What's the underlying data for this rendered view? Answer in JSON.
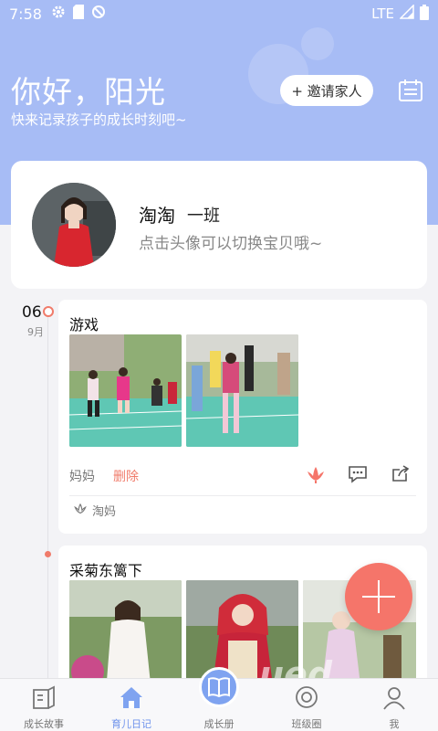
{
  "status_bar": {
    "time": "7:58",
    "network": "LTE"
  },
  "header": {
    "greeting": "你好，阳光",
    "subtitle": "快来记录孩子的成长时刻吧~",
    "invite_label": "+ 邀请家人"
  },
  "profile": {
    "name": "淘淘",
    "class_name": "一班",
    "hint": "点击头像可以切换宝贝哦~"
  },
  "timeline": {
    "day": "06",
    "month": "9月"
  },
  "posts": [
    {
      "title": "游戏",
      "author": "妈妈",
      "delete_label": "删除",
      "liked_by": "淘妈"
    },
    {
      "title": "采菊东篱下"
    }
  ],
  "tabs": [
    {
      "label": "成长故事",
      "icon": "story-icon"
    },
    {
      "label": "育儿日记",
      "icon": "home-icon"
    },
    {
      "label": "成长册",
      "icon": "book-icon"
    },
    {
      "label": "班级圈",
      "icon": "circle-icon"
    },
    {
      "label": "我",
      "icon": "person-icon"
    }
  ],
  "active_tab": "育儿日记",
  "watermark": "ued",
  "colors": {
    "header": "#a7bcf5",
    "accent": "#f5756a",
    "tab_active": "#6f93ec"
  }
}
